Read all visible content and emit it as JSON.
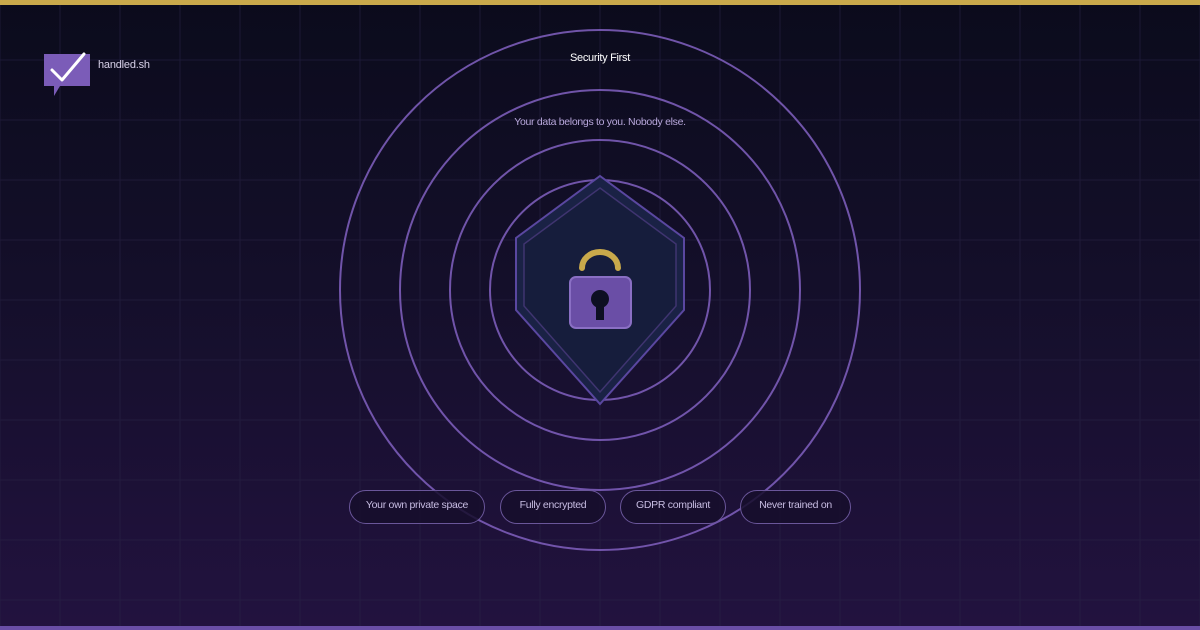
{
  "brand": {
    "name": "handled.sh",
    "logo_icon": "check-speech-bubble-icon"
  },
  "hero": {
    "title": "Security First",
    "subtitle": "Your data belongs to you. Nobody else.",
    "center_icon": "shield-padlock-icon"
  },
  "features": [
    {
      "label": "Your own private space"
    },
    {
      "label": "Fully encrypted"
    },
    {
      "label": "GDPR compliant"
    },
    {
      "label": "Never trained on"
    }
  ],
  "colors": {
    "accent_gold": "#c9a94b",
    "accent_purple": "#7b5cb8",
    "background_dark": "#0b0b1c",
    "background_purple": "#22123f"
  }
}
